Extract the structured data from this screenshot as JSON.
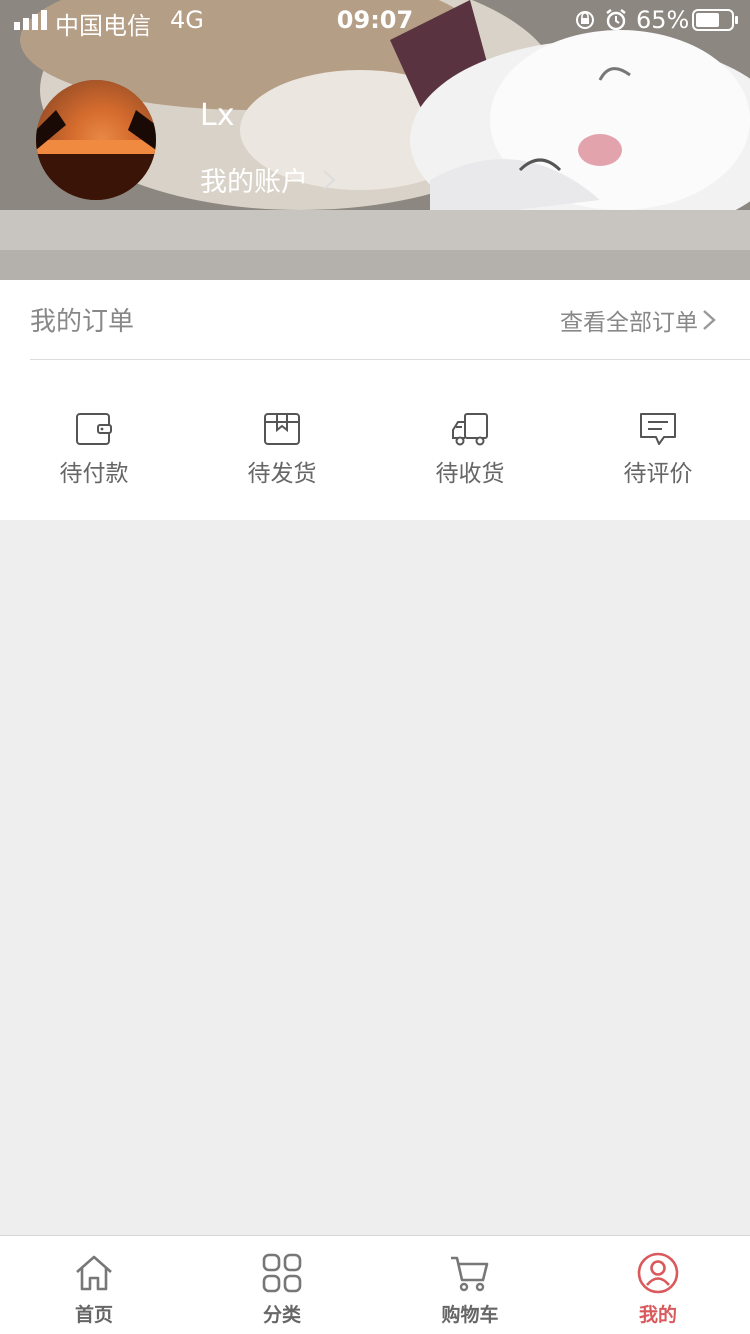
{
  "status_bar": {
    "carrier": "中国电信",
    "network": "4G",
    "time": "09:07",
    "battery": "65%"
  },
  "profile": {
    "username": "Lx",
    "account_link": "我的账户"
  },
  "orders": {
    "title": "我的订单",
    "view_all": "查看全部订单",
    "statuses": [
      {
        "label": "待付款",
        "icon": "wallet-icon"
      },
      {
        "label": "待发货",
        "icon": "package-icon"
      },
      {
        "label": "待收货",
        "icon": "truck-icon"
      },
      {
        "label": "待评价",
        "icon": "comment-icon"
      }
    ]
  },
  "tabbar": {
    "active_color": "#d9595c",
    "tabs": [
      {
        "label": "首页",
        "icon": "home-icon"
      },
      {
        "label": "分类",
        "icon": "grid-icon"
      },
      {
        "label": "购物车",
        "icon": "cart-icon"
      },
      {
        "label": "我的",
        "icon": "user-icon",
        "active": true
      }
    ]
  }
}
